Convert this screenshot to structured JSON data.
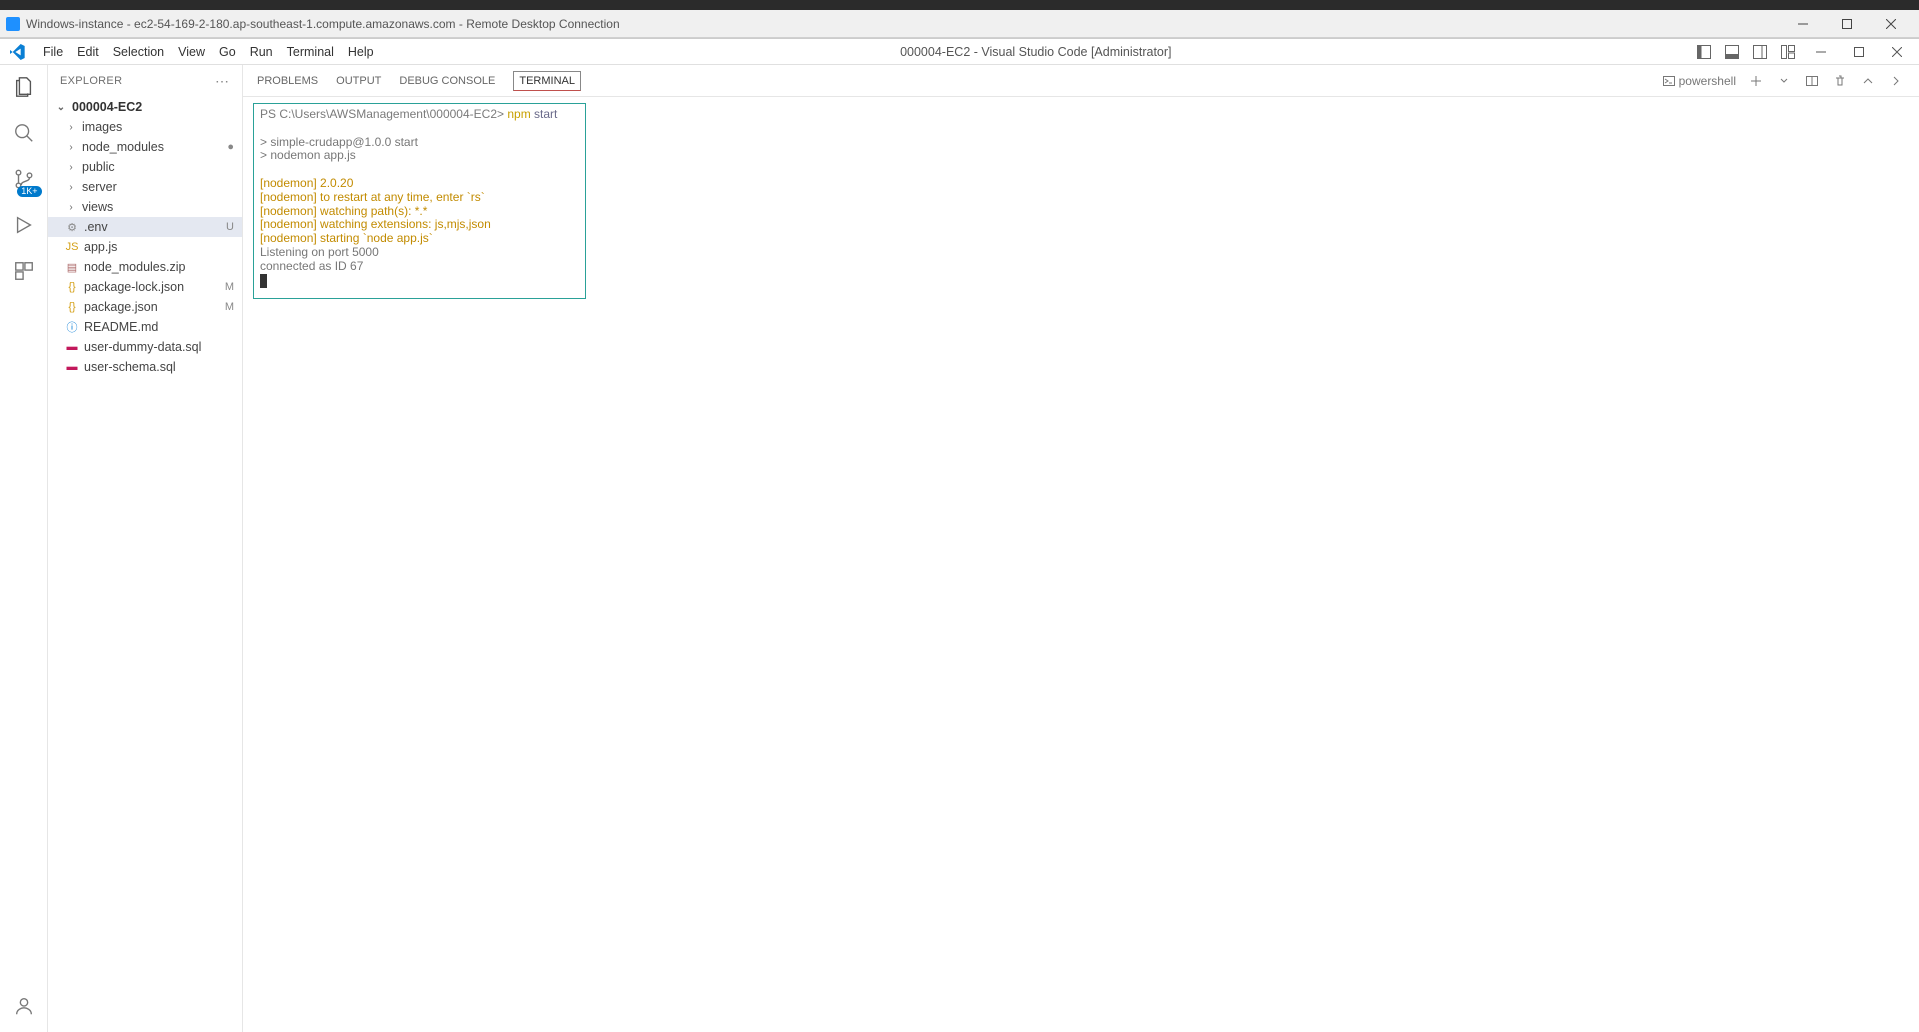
{
  "rdp": {
    "title": "Windows-instance - ec2-54-169-2-180.ap-southeast-1.compute.amazonaws.com - Remote Desktop Connection"
  },
  "vscode": {
    "title": "000004-EC2 - Visual Studio Code [Administrator]",
    "menu": [
      "File",
      "Edit",
      "Selection",
      "View",
      "Go",
      "Run",
      "Terminal",
      "Help"
    ]
  },
  "activitybar": {
    "badge": "1K+"
  },
  "explorer": {
    "header": "EXPLORER",
    "project": "000004-EC2",
    "folders": [
      {
        "name": "images"
      },
      {
        "name": "node_modules",
        "dot": true
      },
      {
        "name": "public"
      },
      {
        "name": "server"
      },
      {
        "name": "views"
      }
    ],
    "files": [
      {
        "name": ".env",
        "kind": "env",
        "status": "U",
        "selected": true
      },
      {
        "name": "app.js",
        "kind": "js"
      },
      {
        "name": "node_modules.zip",
        "kind": "zip"
      },
      {
        "name": "package-lock.json",
        "kind": "json",
        "status": "M"
      },
      {
        "name": "package.json",
        "kind": "json",
        "status": "M"
      },
      {
        "name": "README.md",
        "kind": "md"
      },
      {
        "name": "user-dummy-data.sql",
        "kind": "sql"
      },
      {
        "name": "user-schema.sql",
        "kind": "sql"
      }
    ]
  },
  "panel": {
    "tabs": [
      "PROBLEMS",
      "OUTPUT",
      "DEBUG CONSOLE",
      "TERMINAL"
    ],
    "activeTab": "TERMINAL",
    "shell": "powershell"
  },
  "terminal": {
    "prompt_path": "PS C:\\Users\\AWSManagement\\000004-EC2>",
    "cmd1": "npm",
    "cmd2": "start",
    "line_script1": "> simple-crudapp@1.0.0 start",
    "line_script2": "> nodemon app.js",
    "nodemon": [
      "[nodemon] 2.0.20",
      "[nodemon] to restart at any time, enter `rs`",
      "[nodemon] watching path(s): *.*",
      "[nodemon] watching extensions: js,mjs,json",
      "[nodemon] starting `node app.js`"
    ],
    "out1": "Listening on port 5000",
    "out2": "connected as ID 67"
  }
}
